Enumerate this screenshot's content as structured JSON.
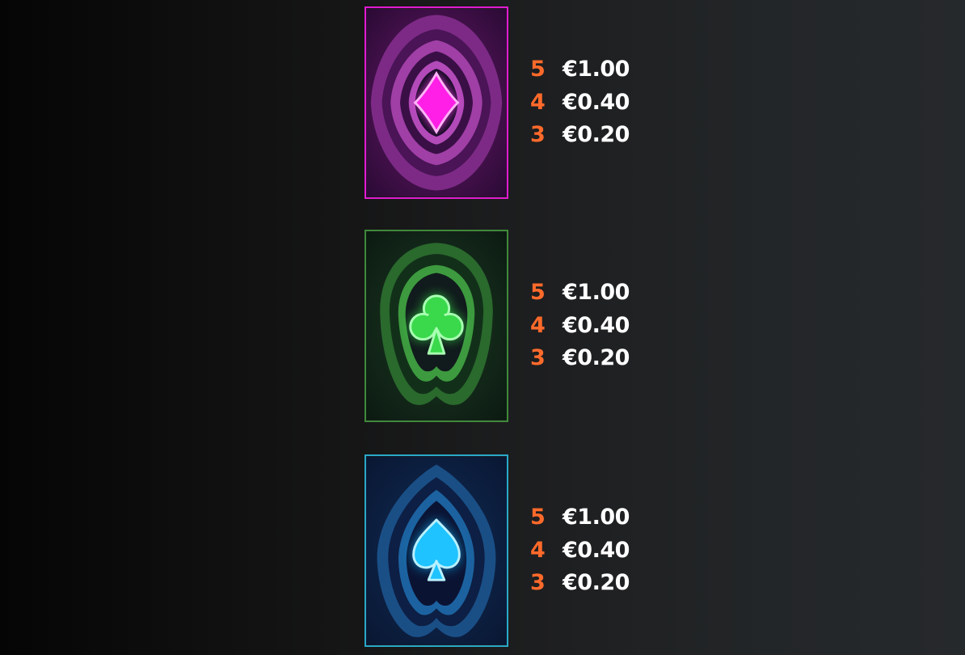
{
  "paytable": {
    "symbols": [
      {
        "symbol": "diamond",
        "icon": "diamond-icon",
        "accent": "#ff2bd6",
        "pays": [
          {
            "count": "5",
            "value": "€1.00"
          },
          {
            "count": "4",
            "value": "€0.40"
          },
          {
            "count": "3",
            "value": "€0.20"
          }
        ]
      },
      {
        "symbol": "club",
        "icon": "club-icon",
        "accent": "#39d353",
        "pays": [
          {
            "count": "5",
            "value": "€1.00"
          },
          {
            "count": "4",
            "value": "€0.40"
          },
          {
            "count": "3",
            "value": "€0.20"
          }
        ]
      },
      {
        "symbol": "spade",
        "icon": "spade-icon",
        "accent": "#19c2ff",
        "pays": [
          {
            "count": "5",
            "value": "€1.00"
          },
          {
            "count": "4",
            "value": "€0.40"
          },
          {
            "count": "3",
            "value": "€0.20"
          }
        ]
      }
    ]
  },
  "colors": {
    "count": "#ff6a2b",
    "value": "#ffffff",
    "background_left": "#050505",
    "background_right": "#26292c"
  }
}
